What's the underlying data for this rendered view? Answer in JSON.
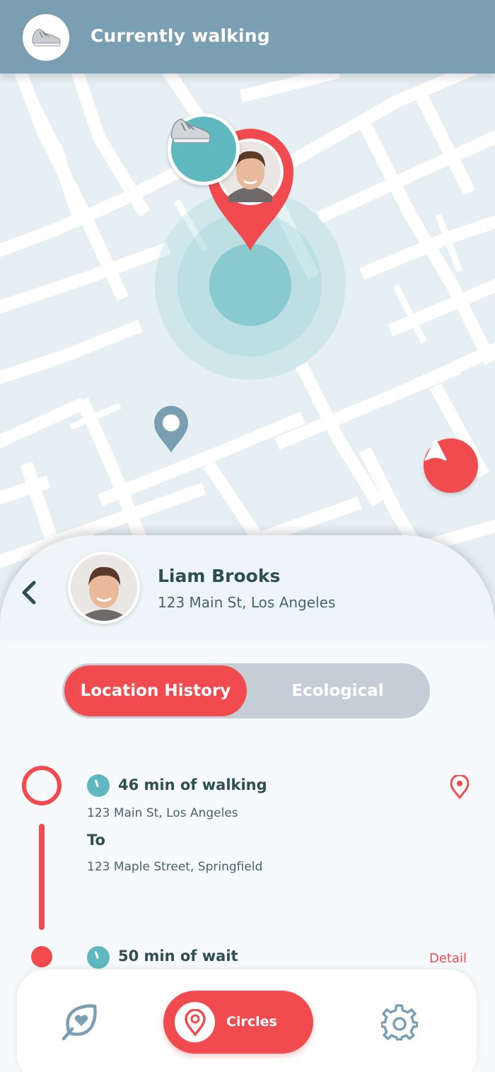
{
  "header": {
    "title": "Currently walking",
    "avatar_icon": "sneaker-icon"
  },
  "map": {
    "walker_avatar_icon": "sneaker-icon",
    "user_pin_icon": "map-pin-icon",
    "secondary_pin_icon": "map-pin-icon",
    "navigate_icon": "navigation-arrow-icon"
  },
  "profile": {
    "name": "Liam Brooks",
    "address": "123 Main St, Los Angeles"
  },
  "tabs": [
    {
      "label": "Location History",
      "active": true
    },
    {
      "label": "Ecological",
      "active": false
    }
  ],
  "timeline": [
    {
      "title": "46 min of walking",
      "from": "123 Main St, Los Angeles",
      "to_label": "To",
      "to": "123 Maple Street, Springfield"
    },
    {
      "title": "50 min of wait",
      "action": "Detail"
    }
  ],
  "bottom_nav": {
    "items": [
      {
        "icon": "leaf-heart-icon",
        "label": ""
      },
      {
        "icon": "location-pin-icon",
        "label": "Circles",
        "active": true
      },
      {
        "icon": "gear-icon",
        "label": ""
      }
    ]
  },
  "colors": {
    "accent": "#f24b4f",
    "header": "#7a9fb3",
    "teal": "#5fb8bf",
    "text_dark": "#2f4f4f"
  }
}
